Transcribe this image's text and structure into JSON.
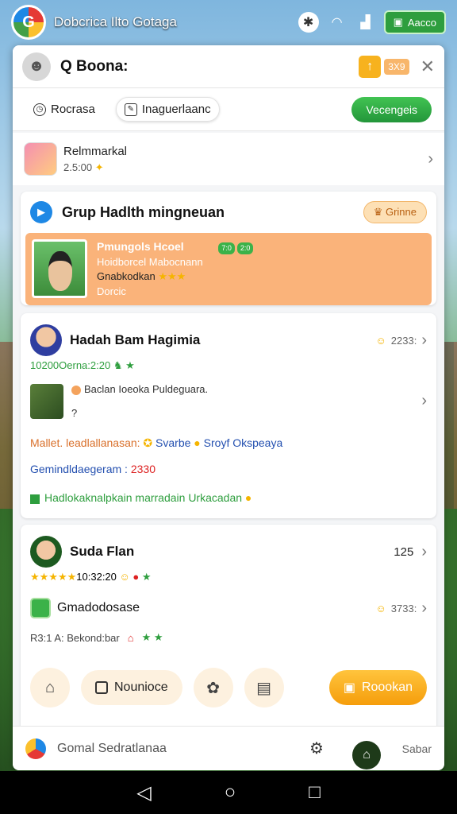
{
  "status_bar": {
    "app_title": "Dobcrica Ilto Gotaga",
    "right_button": "Aacco"
  },
  "topbar": {
    "search_label": "Q Boona:",
    "coin_badge": "3X9"
  },
  "tabs": [
    {
      "label": "Rocrasa"
    },
    {
      "label": "Inaguerlaanc"
    }
  ],
  "green_button": "Vecengeis",
  "first_row": {
    "title": "Relmmarkal",
    "sub": "2.5:00"
  },
  "group": {
    "title": "Grup Hadlth mingneuan",
    "badge": "Grinne",
    "highlight": {
      "title": "Pmungols Hcoel",
      "line2": "Hoidborcel Mabocnann",
      "line3": "Gnabkodkan",
      "line4": "Dorcic",
      "tags": [
        "7:0",
        "2:0"
      ]
    }
  },
  "post1": {
    "name": "Hadah Bam Hagimia",
    "count": "2233:",
    "meta": "10200Oerna:2:20",
    "sub_text": "Baclan Ioeoka Puldeguara.",
    "sub_text2": "?",
    "info1_label": "Mallet. leadlallanasan:",
    "info1_link1": "Svarbe",
    "info1_link2": "Sroyf Okspeaya",
    "info2_label": "Gemindldaegeram :",
    "info2_value": "2330",
    "check_text": "Hadlokaknalpkain marradain Urkacadan"
  },
  "post2": {
    "name": "Suda Flan",
    "count": "125",
    "meta": "10:32:20",
    "game_name": "Gmadodosase",
    "game_count": "3733:",
    "line": "R3:1 A: Bekond:bar"
  },
  "actions": {
    "nounce_label": "Nounioce",
    "primary_label": "Roookan"
  },
  "footer": {
    "label": "Gomal Sedratlanaa",
    "right_text": "Sabar"
  },
  "colors": {
    "accent_green": "#2e9e3e",
    "accent_orange": "#fab37a",
    "accent_yellow": "#f5a30f",
    "link_blue": "#2450b0"
  }
}
